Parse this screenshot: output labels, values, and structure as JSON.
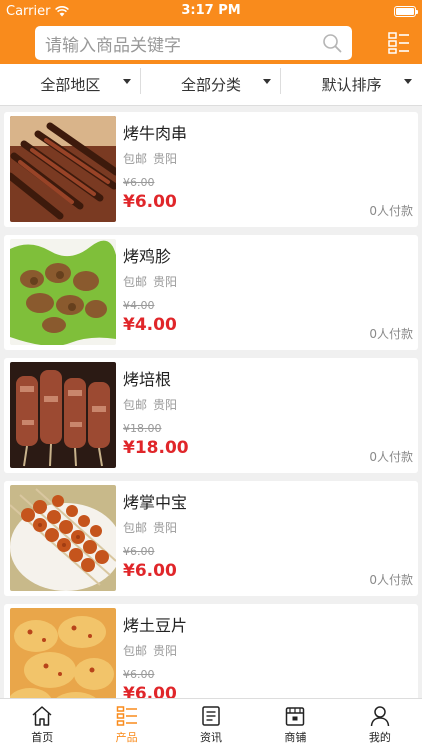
{
  "status": {
    "carrier": "Carrier",
    "time": "3:17 PM"
  },
  "search": {
    "placeholder": "请输入商品关键字"
  },
  "filters": [
    {
      "label": "全部地区"
    },
    {
      "label": "全部分类"
    },
    {
      "label": "默认排序"
    }
  ],
  "products": [
    {
      "name": "烤牛肉串",
      "shipping": "包邮",
      "city": "贵阳",
      "old_price": "¥6.00",
      "price": "¥6.00",
      "paid": "0人付款"
    },
    {
      "name": "烤鸡胗",
      "shipping": "包邮",
      "city": "贵阳",
      "old_price": "¥4.00",
      "price": "¥4.00",
      "paid": "0人付款"
    },
    {
      "name": "烤培根",
      "shipping": "包邮",
      "city": "贵阳",
      "old_price": "¥18.00",
      "price": "¥18.00",
      "paid": "0人付款"
    },
    {
      "name": "烤掌中宝",
      "shipping": "包邮",
      "city": "贵阳",
      "old_price": "¥6.00",
      "price": "¥6.00",
      "paid": "0人付款"
    },
    {
      "name": "烤土豆片",
      "shipping": "包邮",
      "city": "贵阳",
      "old_price": "¥6.00",
      "price": "¥6.00",
      "paid": ""
    }
  ],
  "tabs": [
    {
      "label": "首页",
      "icon": "home-icon"
    },
    {
      "label": "产品",
      "icon": "list-icon"
    },
    {
      "label": "资讯",
      "icon": "news-icon"
    },
    {
      "label": "商铺",
      "icon": "shop-icon"
    },
    {
      "label": "我的",
      "icon": "user-icon"
    }
  ],
  "colors": {
    "accent": "#f98b1c",
    "price": "#e0262a"
  }
}
